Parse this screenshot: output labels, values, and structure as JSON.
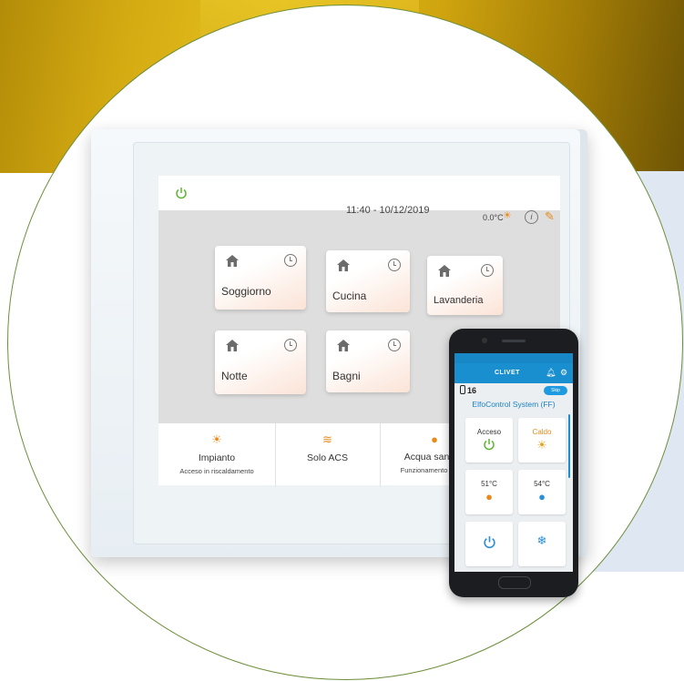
{
  "tablet": {
    "clock": "11:40 - 10/12/2019",
    "outdoor_temp": "0.0°C",
    "rooms": [
      {
        "label": "Soggiorno"
      },
      {
        "label": "Cucina"
      },
      {
        "label": "Lavanderia"
      },
      {
        "label": "Notte"
      },
      {
        "label": "Bagni"
      }
    ],
    "modes": [
      {
        "title": "Impianto",
        "subtitle": "Acceso in riscaldamento"
      },
      {
        "title": "Solo ACS",
        "subtitle": ""
      },
      {
        "title": "Acqua sanitari",
        "subtitle": "Funzionamento autom"
      }
    ]
  },
  "phone": {
    "brand": "CLIVET",
    "number": "16",
    "button": "Skip",
    "title": "ElfoControl System (FF)",
    "cards": [
      {
        "value": "Acceso"
      },
      {
        "value": "Caldo"
      },
      {
        "value": "51°C"
      },
      {
        "value": "54°C"
      },
      {
        "value": ""
      },
      {
        "value": ""
      }
    ]
  },
  "colors": {
    "accent": "#1a8fd0",
    "power_green": "#5cb531",
    "orange": "#e88a1a"
  }
}
